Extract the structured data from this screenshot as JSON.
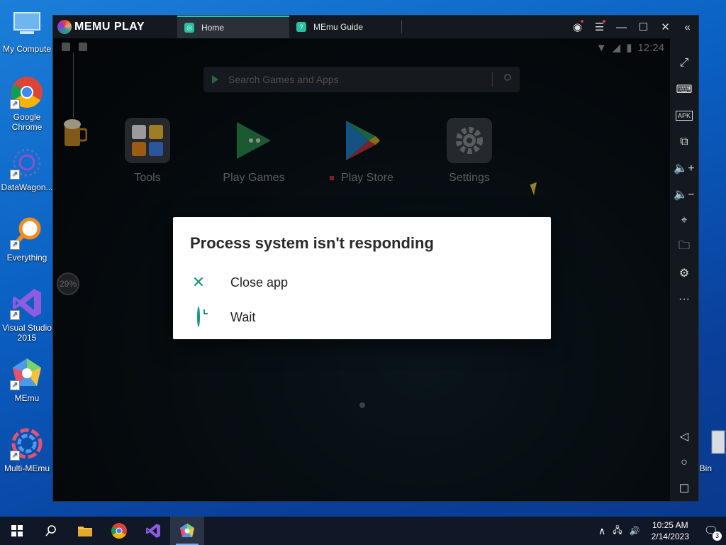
{
  "desktop": {
    "icons": [
      {
        "label": "My Compute"
      },
      {
        "label": "Google Chrome"
      },
      {
        "label": "DataWagon..."
      },
      {
        "label": "Everything"
      },
      {
        "label": "Visual Studio 2015"
      },
      {
        "label": "MEmu"
      },
      {
        "label": "Multi-MEmu"
      },
      {
        "label": "Bin"
      }
    ]
  },
  "memu": {
    "brand": "MEMU PLAY",
    "tabs": [
      {
        "label": "Home",
        "icon": "memu-icon"
      },
      {
        "label": "MEmu Guide",
        "icon": "help-icon"
      }
    ],
    "status_time": "12:24",
    "search_placeholder": "Search Games and Apps",
    "apps": [
      {
        "label": "Tools"
      },
      {
        "label": "Play Games"
      },
      {
        "label": "Play Store"
      },
      {
        "label": "Settings"
      }
    ],
    "progress_badge": "29%",
    "dialog": {
      "title": "Process system isn't responding",
      "close_label": "Close app",
      "wait_label": "Wait"
    },
    "sidebar": [
      "fullscreen-icon",
      "keyboard-icon",
      "apk-icon",
      "multi-window-icon",
      "volume-up-icon",
      "volume-down-icon",
      "location-icon",
      "folder-icon",
      "settings-icon",
      "more-icon",
      "back-icon",
      "home-icon",
      "recents-icon"
    ],
    "apk_label": "APK"
  },
  "taskbar": {
    "time": "10:25 AM",
    "date": "2/14/2023",
    "notification_count": "3"
  },
  "colors": {
    "accent": "#18977f",
    "tab_accent": "#2cc6b0",
    "taskbar": "#101726"
  }
}
